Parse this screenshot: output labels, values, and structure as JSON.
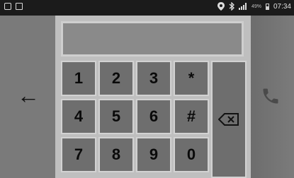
{
  "status_bar": {
    "battery_text": "49%",
    "time": "07:34",
    "icons": [
      "image-icon",
      "message-icon",
      "location-icon",
      "bluetooth-icon",
      "signal-icon",
      "battery-icon"
    ]
  },
  "keypad": {
    "rows": [
      [
        "1",
        "2",
        "3",
        "*"
      ],
      [
        "4",
        "5",
        "6",
        "#"
      ],
      [
        "7",
        "8",
        "9",
        "0"
      ]
    ],
    "display_value": ""
  },
  "icons": {
    "back": "left-arrow-icon",
    "delete": "backspace-icon",
    "call": "phone-icon"
  },
  "back_arrow_glyph": "←",
  "colors": {
    "background": "#6a6a6a",
    "keypad_frame": "#bfbfbf",
    "key": "#6e6e6e",
    "key_border": "#d2d2d2"
  }
}
